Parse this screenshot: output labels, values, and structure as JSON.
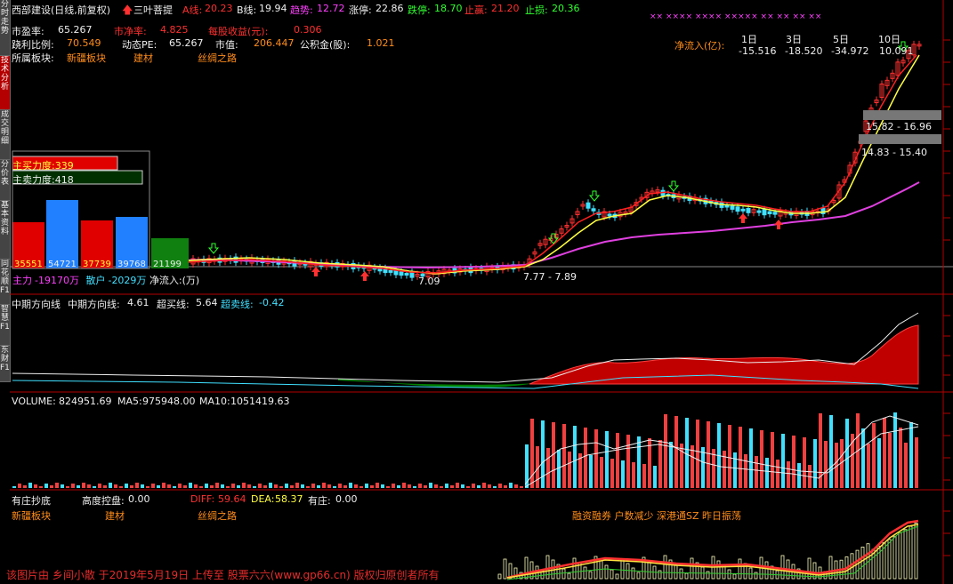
{
  "colors": {
    "up": "#ff3030",
    "down": "#40e0ff",
    "ma_yellow": "#ffff40",
    "ma_magenta": "#e040e0",
    "bg": "#000000",
    "grid": "#b40000"
  },
  "header": {
    "stock": "西部建设(日线,前复权)",
    "indicator": "三叶菩提",
    "a_label": "A线:",
    "a_val": "20.23",
    "b_label": "B线:",
    "b_val": "19.94",
    "trend_label": "趋势:",
    "trend_val": "12.72",
    "limitup_label": "涨停:",
    "limitup_val": "22.86",
    "limitdown_label": "跌停:",
    "limitdown_val": "18.70",
    "stopprofit_label": "止赢:",
    "stopprofit_val": "21.20",
    "stoploss_label": "止损:",
    "stoploss_val": "20.36"
  },
  "fund": {
    "pe_label": "市盈率:",
    "pe_val": "65.267",
    "pb_label": "市净率:",
    "pb_val": "4.825",
    "eps_label": "每股收益(元):",
    "eps_val": "0.306",
    "ratio_label": "跷利比例:",
    "ratio_val": "70.549",
    "dpe_label": "动态PE:",
    "dpe_val": "65.267",
    "mv_label": "市值:",
    "mv_val": "206.447",
    "fund_label": "公积金(股):",
    "fund_val": "1.021",
    "sector_label": "所属板块:",
    "sectors": [
      "新疆板块",
      "建材",
      "丝绸之路"
    ]
  },
  "netflow": {
    "label": "净流入(亿):",
    "cols": [
      "1日",
      "3日",
      "5日",
      "10日"
    ],
    "vals": [
      "-15.516",
      "-18.520",
      "-34.972",
      "10.091"
    ]
  },
  "pricebands": [
    "15.82 - 16.96",
    "14.83 - 15.40"
  ],
  "lowlabels": {
    "low": "7.09",
    "range": "7.77 - 7.89"
  },
  "forcepanel": {
    "buy_label": "主买力度:",
    "buy_val": "339",
    "sell_label": "主卖力度:",
    "sell_val": "418",
    "bars": [
      "35551",
      "54721",
      "37739",
      "39768",
      "21199"
    ],
    "main_label": "主力",
    "main_val": "-19170万",
    "retail_label": "散户",
    "retail_val": "-2029万",
    "net_label": "净流入:(万)"
  },
  "trendpanel": {
    "title": "中期方向线",
    "mid_label": "中期方向线:",
    "mid_val": "4.61",
    "ob_label": "超买线:",
    "ob_val": "5.64",
    "os_label": "超卖线:",
    "os_val": "-0.42"
  },
  "volpanel": {
    "vol_label": "VOLUME:",
    "vol_val": "824951.69",
    "ma5_label": "MA5:",
    "ma5_val": "975948.00",
    "ma10_label": "MA10:",
    "ma10_val": "1051419.63"
  },
  "bottompanel": {
    "title": "有庄抄底",
    "ctrl_label": "高度控盘:",
    "ctrl_val": "0.00",
    "diff_label": "DIFF:",
    "diff_val": "59.64",
    "dea_label": "DEA:",
    "dea_val": "58.37",
    "zhuang_label": "有庄:",
    "zhuang_val": "0.00",
    "sectors": [
      "新疆板块",
      "建材",
      "丝绸之路"
    ],
    "tags": "融资融券 户数减少 深港通SZ 昨日振荡"
  },
  "watermark": "该图片由 乡间小散 于2019年5月19日 上传至 股票六六(www.gp66.cn) 版权归原创者所有",
  "sidetabs": [
    "分时走势",
    "技术分析",
    "成交明细",
    "分价表",
    "基本资料",
    "同花顺F10",
    "智慧F10",
    "东财F10"
  ]
}
